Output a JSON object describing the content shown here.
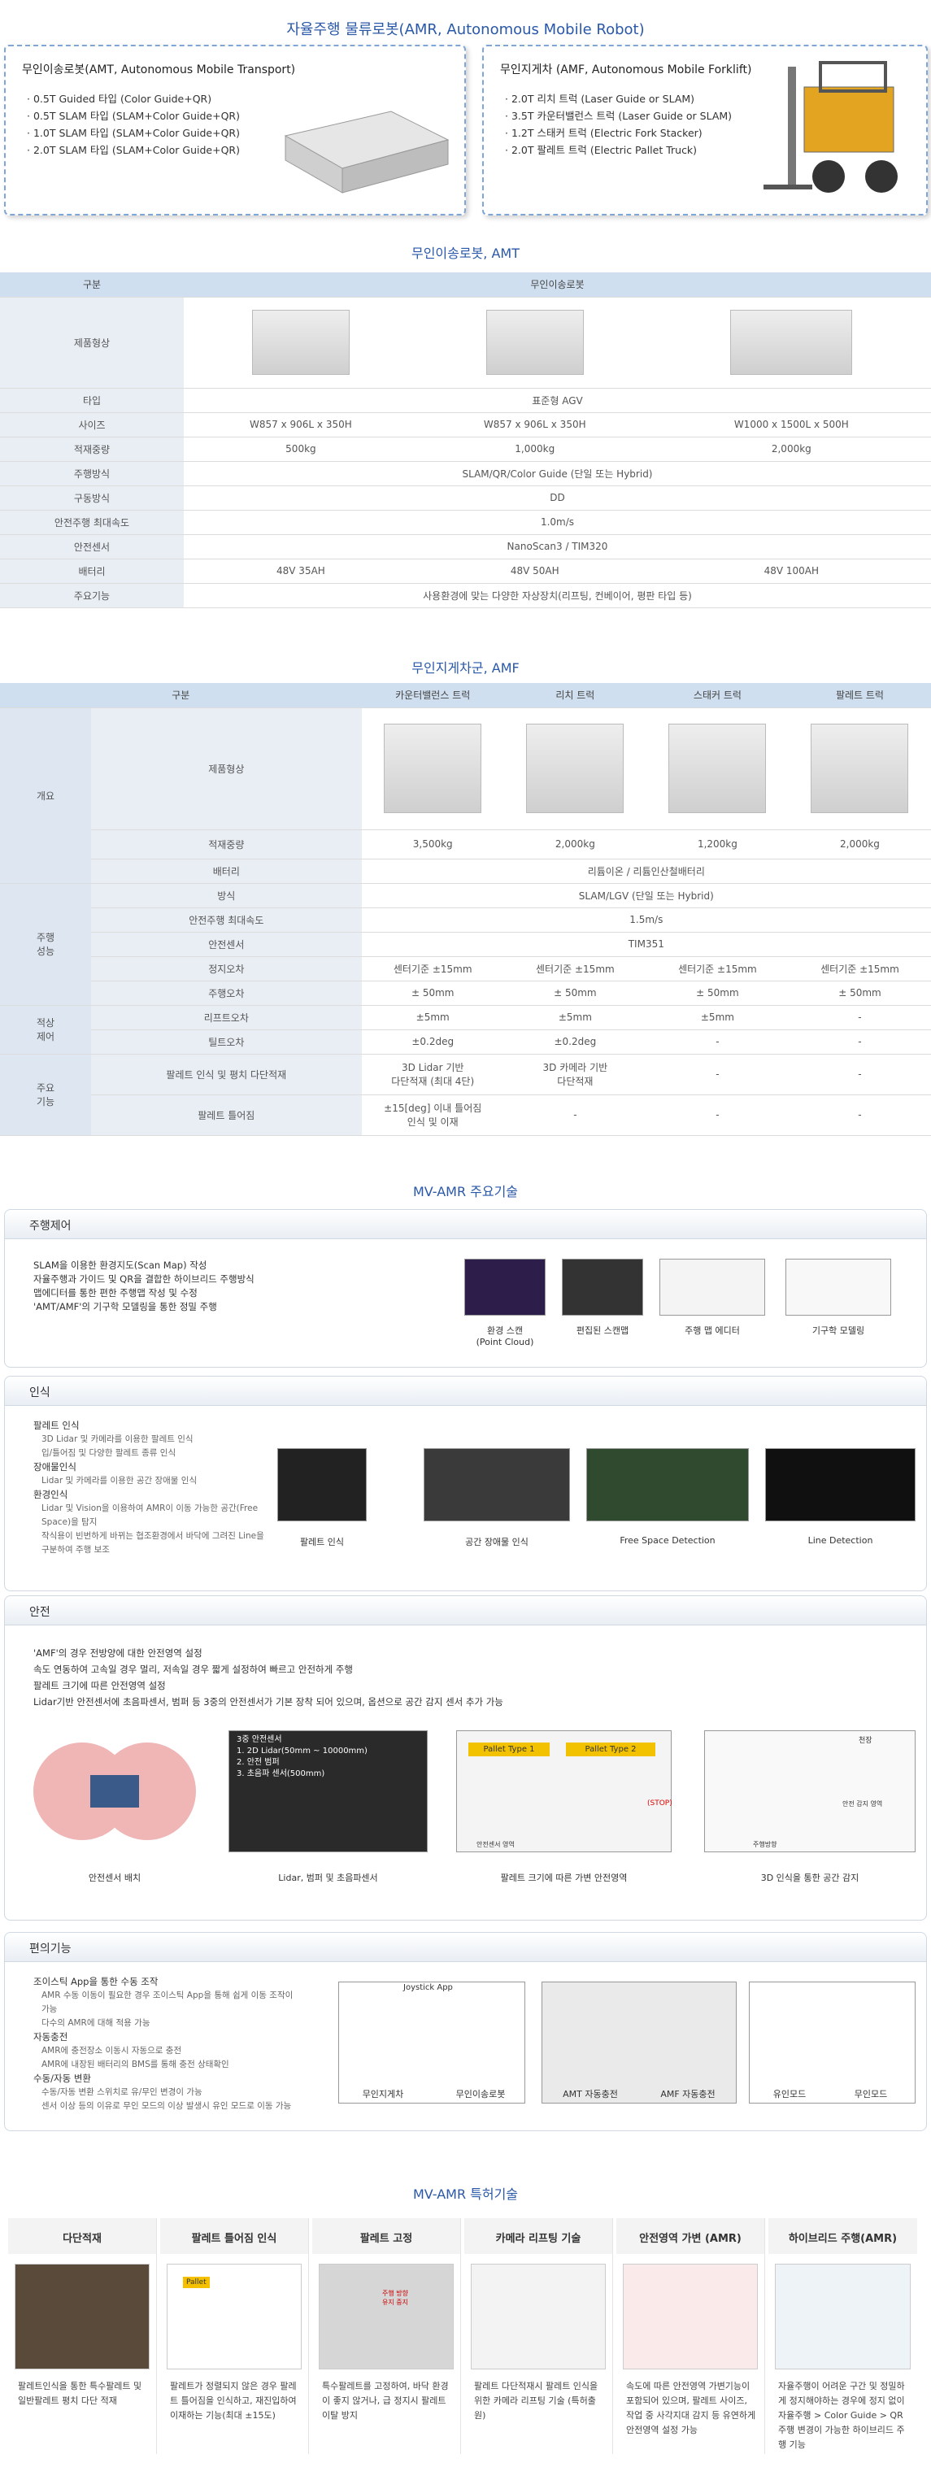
{
  "header": {
    "title": "자율주행 물류로봇(AMR, Autonomous Mobile Robot)"
  },
  "card_amt": {
    "title": "무인이송로봇(AMT, Autonomous Mobile Transport)",
    "items": [
      "0.5T Guided 타입 (Color Guide+QR)",
      "0.5T SLAM 타입 (SLAM+Color Guide+QR)",
      "1.0T SLAM 타입 (SLAM+Color Guide+QR)",
      "2.0T SLAM 타입 (SLAM+Color Guide+QR)"
    ]
  },
  "card_amf": {
    "title": "무인지게차 (AMF, Autonomous Mobile Forklift)",
    "items": [
      "2.0T 리치 트럭 (Laser Guide or SLAM)",
      "3.5T 카운터밸런스 트럭 (Laser Guide or SLAM)",
      "1.2T 스태커 트럭 (Electric Fork Stacker)",
      "2.0T 팔레트 트럭 (Electric Pallet Truck)"
    ]
  },
  "amt_table": {
    "title": "무인이송로봇, AMT",
    "h_cat": "구분",
    "h_main": "무인이송로봇",
    "rows": {
      "shape": "제품형상",
      "type": "타입",
      "type_v": "표준형 AGV",
      "size": "사이즈",
      "size_v": [
        "W857 x 906L x 350H",
        "W857 x 906L x 350H",
        "W1000 x 1500L x 500H"
      ],
      "load": "적재중량",
      "load_v": [
        "500kg",
        "1,000kg",
        "2,000kg"
      ],
      "drive": "주행방식",
      "drive_v": "SLAM/QR/Color Guide (단일 또는 Hybrid)",
      "mode": "구동방식",
      "mode_v": "DD",
      "speed": "안전주행 최대속도",
      "speed_v": "1.0m/s",
      "sensor": "안전센서",
      "sensor_v": "NanoScan3 / TIM320",
      "battery": "배터리",
      "battery_v": [
        "48V 35AH",
        "48V 50AH",
        "48V 100AH"
      ],
      "func": "주요기능",
      "func_v": "사용환경에 맞는 다양한 자상장치(리프팅, 컨베이어, 평판 타입 등)"
    }
  },
  "amf_table": {
    "title": "무인지게차군, AMF",
    "h_cat": "구분",
    "cols": [
      "카운터밸런스 트럭",
      "리치 트럭",
      "스태커 트럭",
      "팔레트 트럭"
    ],
    "g_overview": "개요",
    "shape": "제품형상",
    "load": "적재중량",
    "load_v": [
      "3,500kg",
      "2,000kg",
      "1,200kg",
      "2,000kg"
    ],
    "battery": "배터리",
    "battery_v": "리튬이온 / 리튬인산철배터리",
    "g_drive": "주행\n성능",
    "method": "방식",
    "method_v": "SLAM/LGV (단일 또는 Hybrid)",
    "speed": "안전주행 최대속도",
    "speed_v": "1.5m/s",
    "sensor": "안전센서",
    "sensor_v": "TIM351",
    "stop": "정지오차",
    "stop_v": [
      "센터기준 ±15mm",
      "센터기준 ±15mm",
      "센터기준 ±15mm",
      "센터기준 ±15mm"
    ],
    "run": "주행오차",
    "run_v": [
      "± 50mm",
      "± 50mm",
      "± 50mm",
      "± 50mm"
    ],
    "g_load": "적상\n제어",
    "lift": "리프트오차",
    "lift_v": [
      "±5mm",
      "±5mm",
      "±5mm",
      "-"
    ],
    "tilt": "틸트오차",
    "tilt_v": [
      "±0.2deg",
      "±0.2deg",
      "-",
      "-"
    ],
    "g_main": "주요\n기능",
    "stack": "팔레트 인식 및 평치 다단적재",
    "stack_v": [
      "3D Lidar 기반\n다단적재 (최대 4단)",
      "3D 카메라 기반\n다단적재",
      "-",
      "-"
    ],
    "tilted": "팔레트 틀어짐",
    "tilted_v": [
      "±15[deg] 이내 틀어짐\n인식 및 이재",
      "-",
      "-",
      "-"
    ]
  },
  "tech": {
    "title": "MV-AMR 주요기술",
    "drive": {
      "head": "주행제어",
      "bullets": [
        "SLAM을 이용한 환경지도(Scan Map) 작성",
        "자율주행과 가이드 및 QR을 결합한 하이브리드 주행방식",
        "맵에디터를 통한 편한 주행맵 작성 및 수정",
        "'AMT/AMF'의 기구학 모델링을 통한 정밀 주행"
      ],
      "caps": [
        "환경 스캔\n(Point Cloud)",
        "편집된 스캔맵",
        "주행 맵 에디터",
        "기구학 모델링"
      ]
    },
    "recog": {
      "head": "인식",
      "b1": "팔레트 인식",
      "b1s": [
        "3D Lidar 및 카메라를 이용한 팔레트 인식",
        "입/틀어짐 및 다양한 팔레트 종류 인식"
      ],
      "b2": "장애물인식",
      "b2s": [
        "Lidar 및 카메라를 이용한 공간 장애물 인식"
      ],
      "b3": "환경인식",
      "b3s": [
        "Lidar 및 Vision을 이용하여 AMR이 이동 가능한 공간(Free Space)을 탐지",
        "작식용이 빈번하게 바뀌는 협조환경에서 바닥에 그려진 Line을 구분하여 주행 보조"
      ],
      "caps": [
        "팔레트 인식",
        "공간 장애물 인식",
        "Free Space Detection",
        "Line Detection"
      ]
    },
    "safety": {
      "head": "안전",
      "bullets": [
        "'AMF'의 경우 전방양에 대한 안전영역 설정",
        "속도 연동하여 고속일 경우 멀리, 저속일 경우 짧게 설정하여 빠르고 안전하게 주행",
        "팔레트 크기에 따른 안전영역 설정",
        "Lidar기반 안전센서에 초음파센서, 범퍼 등 3중의 안전센서가 기본 장착 되어 있으며, 옵션으로 공간 감지 센서 추가 가능"
      ],
      "lidar_title": "3중 안전센서",
      "lidar_list": [
        "1. 2D Lidar(50mm ~ 10000mm)",
        "2. 안전 범퍼",
        "3. 초음파 센서(500mm)"
      ],
      "pallet1": "Pallet Type 1",
      "pallet2": "Pallet Type 2",
      "stop": "(STOP)",
      "zone": "안전센서 영역",
      "ceiling": "천장",
      "detect": "안전 감지 영역",
      "dir": "주행방향",
      "caps": [
        "안전센서 배치",
        "Lidar, 범퍼 및 초음파센서",
        "팔레트 크기에 따른 가변 안전영역",
        "3D 인식을 통한 공간 감지"
      ]
    },
    "conv": {
      "head": "편의기능",
      "b1": "조이스틱 App을 통한 수동 조작",
      "b1s": [
        "AMR 수동 이동이 필요한 경우 조이스틱 App을 통해 쉽게 이동 조작이 가능",
        "다수의 AMR에 대해 적용 가능"
      ],
      "b2": "자동충전",
      "b2s": [
        "AMR에 충전장소 이동시 자동으로 충전",
        "AMR에 내장된 배터리의 BMS를 통해 충전 상태확인"
      ],
      "b3": "수동/자동 변환",
      "b3s": [
        "수동/자동 변환 스위치로 유/무인 변경이 가능",
        "센서 이상 등의 이유로 무인 모드의 이상 발생시 유인 모드로 이동 가능"
      ],
      "joystick": "Joystick App",
      "caps": [
        "무인지게차",
        "무인이송로봇",
        "AMT 자동충전",
        "AMF 자동충전",
        "유인모드",
        "무인모드"
      ]
    }
  },
  "patents": {
    "title": "MV-AMR 특허기술",
    "items": [
      {
        "h": "다단적재",
        "t": "팔레트인식을 통한 특수팔레트 및 일반팔레트 평치 다단 적재"
      },
      {
        "h": "팔레트 틀어짐 인식",
        "t": "팔레트가 정렬되지 않은 경우 팔레트 틀어짐을 인식하고, 재진입하여 이재하는 기능(최대 ±15도)"
      },
      {
        "h": "팔레트 고정",
        "t": "특수팔레트를 고정하여, 바닥 환경이 좋지 않거나, 급 정지시 팔레트 이탈 방지"
      },
      {
        "h": "카메라 리프팅 기술",
        "t": "팔레트 다단적재시 팔레트 인식을 위한 카메라 리프팅 기술 (특허출원)"
      },
      {
        "h": "안전영역 가변 (AMR)",
        "t": "속도에 따른 안전영역 가변기능이 포함되어 있으며, 팔레트 사이즈, 작업 중 사각지대 감지 등 유연하게 안전영역 설정 가능"
      },
      {
        "h": "하이브리드 주행(AMR)",
        "t": "자율주행이 어려운 구간 및 정밀하게 정지해야하는 경우에 정지 없이 자율주행 > Color Guide > QR 주행 변경이 가능한 하이브리드 주행 기능"
      }
    ],
    "pallet_label": "Pallet",
    "stop_label": "주행 방향\n유지 중지"
  }
}
